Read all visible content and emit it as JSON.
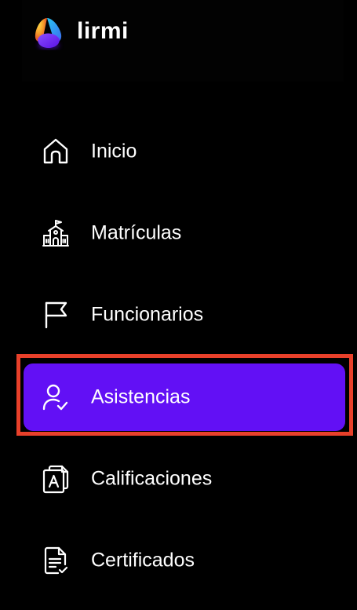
{
  "brand": {
    "name": "lirmi",
    "logo_icon": "lirmi-logo-icon"
  },
  "colors": {
    "accent": "#6210f5",
    "highlight_border": "#e8402a",
    "background": "#000000",
    "text": "#ffffff"
  },
  "sidebar": {
    "items": [
      {
        "label": "Inicio",
        "icon": "home-icon",
        "active": false
      },
      {
        "label": "Matrículas",
        "icon": "school-building-icon",
        "active": false
      },
      {
        "label": "Funcionarios",
        "icon": "flag-icon",
        "active": false
      },
      {
        "label": "Asistencias",
        "icon": "user-check-icon",
        "active": true
      },
      {
        "label": "Calificaciones",
        "icon": "grade-document-icon",
        "active": false
      },
      {
        "label": "Certificados",
        "icon": "certificate-document-icon",
        "active": false
      }
    ]
  }
}
